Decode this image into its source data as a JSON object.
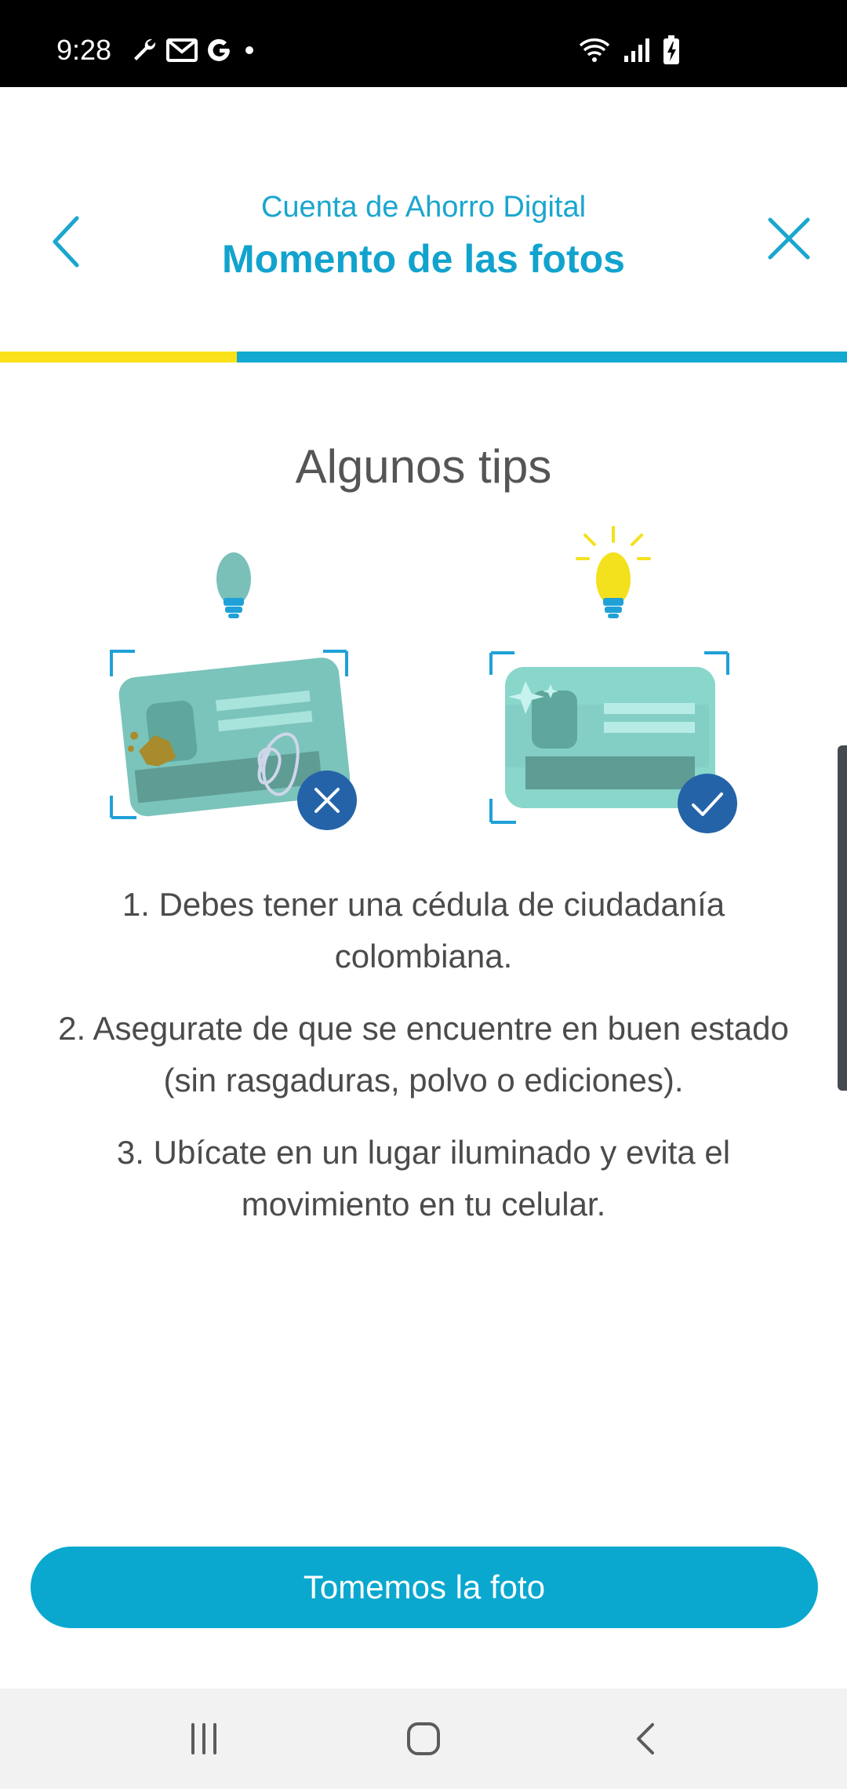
{
  "status_bar": {
    "time": "9:28",
    "icons_left": [
      "wrench-icon",
      "mail-icon",
      "google-icon",
      "dot-icon"
    ],
    "icons_right": [
      "wifi-icon",
      "signal-icon",
      "battery-charging-icon"
    ]
  },
  "header": {
    "subtitle": "Cuenta de Ahorro Digital",
    "title": "Momento de las fotos",
    "back_icon": "chevron-left-icon",
    "close_icon": "close-icon"
  },
  "progress": {
    "value": 0.28,
    "fill_color": "#fbe11a",
    "track_color": "#13a9d0"
  },
  "main": {
    "section_title": "Algunos tips",
    "illustrations": [
      {
        "name": "bad-id-card",
        "bulb": "off",
        "badge": "x"
      },
      {
        "name": "good-id-card",
        "bulb": "on",
        "badge": "check"
      }
    ],
    "tips": [
      "1. Debes tener una cédula de ciudadanía colombiana.",
      "2. Asegurate de que se encuentre en buen estado (sin rasgaduras, polvo o ediciones).",
      "3. Ubícate en un lugar iluminado y evita el movimiento en tu celular."
    ]
  },
  "cta": {
    "label": "Tomemos la foto"
  },
  "nav": {
    "items": [
      "recent-apps-icon",
      "home-icon",
      "back-icon"
    ]
  },
  "colors": {
    "accent": "#11a3cd",
    "button": "#0aa8cf",
    "progress_yellow": "#fbe11a",
    "badge_blue": "#2463a8"
  }
}
